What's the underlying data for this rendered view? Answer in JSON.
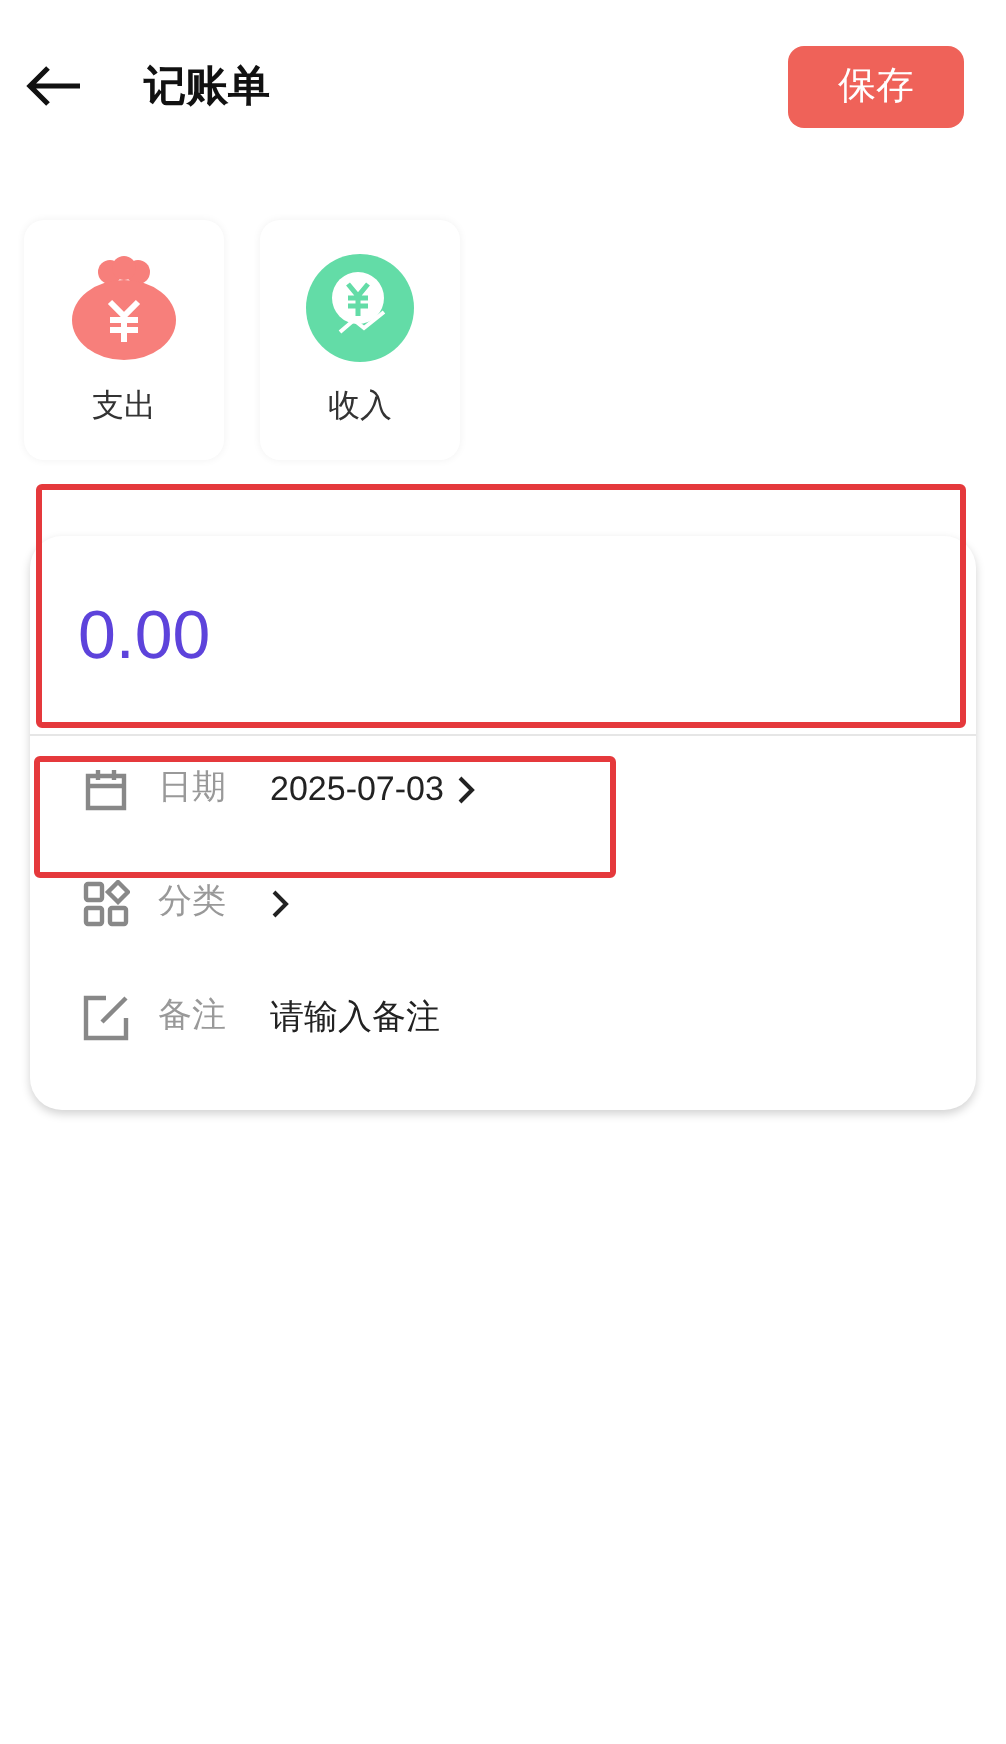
{
  "header": {
    "title": "记账单",
    "save_button": "保存"
  },
  "types": [
    {
      "kind": "expense",
      "label": "支出",
      "selected": false
    },
    {
      "kind": "income",
      "label": "收入",
      "selected": false
    }
  ],
  "amount": {
    "value": "0.00",
    "highlighted": true
  },
  "fields": [
    {
      "kind": "date",
      "label": "日期",
      "value": "2025-07-03",
      "highlighted": true
    },
    {
      "kind": "category",
      "label": "分类",
      "highlighted": false
    },
    {
      "kind": "note",
      "label": "备注",
      "placeholder": "请输入备注",
      "highlighted": false
    }
  ]
}
